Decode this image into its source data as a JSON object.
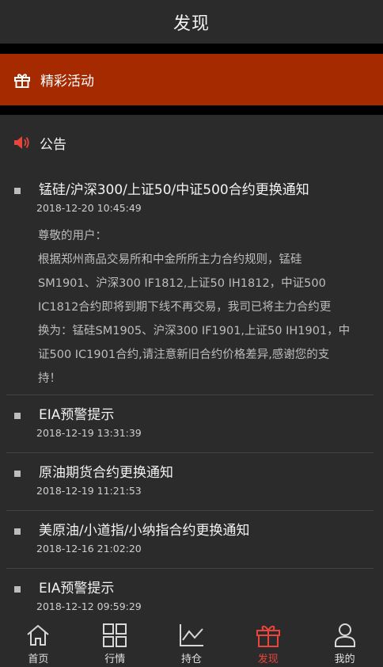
{
  "header": {
    "title": "发现"
  },
  "banner": {
    "label": "精彩活动",
    "icon": "gift-icon",
    "color": "#a52a00"
  },
  "notices": {
    "label": "公告",
    "icon": "speaker-icon",
    "items": [
      {
        "title": "锰硅/沪深300/上证50/中证500合约更换通知",
        "time": "2018-12-20 10:45:49",
        "body_lines": [
          "尊敬的用户：",
          "根据郑州商品交易所和中金所所主力合约规则，锰硅",
          "SM1901、沪深300 IF1812,上证50 IH1812，中证500",
          "IC1812合约即将到期下线不再交易，我司已将主力合约更",
          "换为：锰硅SM1905、沪深300 IF1901,上证50 IH1901，中",
          "证500 IC1901合约,请注意新旧合约价格差异,感谢您的支",
          "持！"
        ]
      },
      {
        "title": "EIA预警提示",
        "time": "2018-12-19 13:31:39"
      },
      {
        "title": "原油期货合约更换通知",
        "time": "2018-12-19 11:21:53"
      },
      {
        "title": "美原油/小道指/小纳指合约更换通知",
        "time": "2018-12-16 21:02:20"
      },
      {
        "title": "EIA预警提示",
        "time": "2018-12-12 09:59:29"
      }
    ]
  },
  "tabbar": {
    "active_color": "#e8453c",
    "tabs": [
      {
        "label": "首页",
        "icon": "home-icon"
      },
      {
        "label": "行情",
        "icon": "grid-icon"
      },
      {
        "label": "持仓",
        "icon": "line-chart-icon"
      },
      {
        "label": "发现",
        "icon": "gift-icon",
        "active": true
      },
      {
        "label": "我的",
        "icon": "user-icon"
      }
    ]
  }
}
